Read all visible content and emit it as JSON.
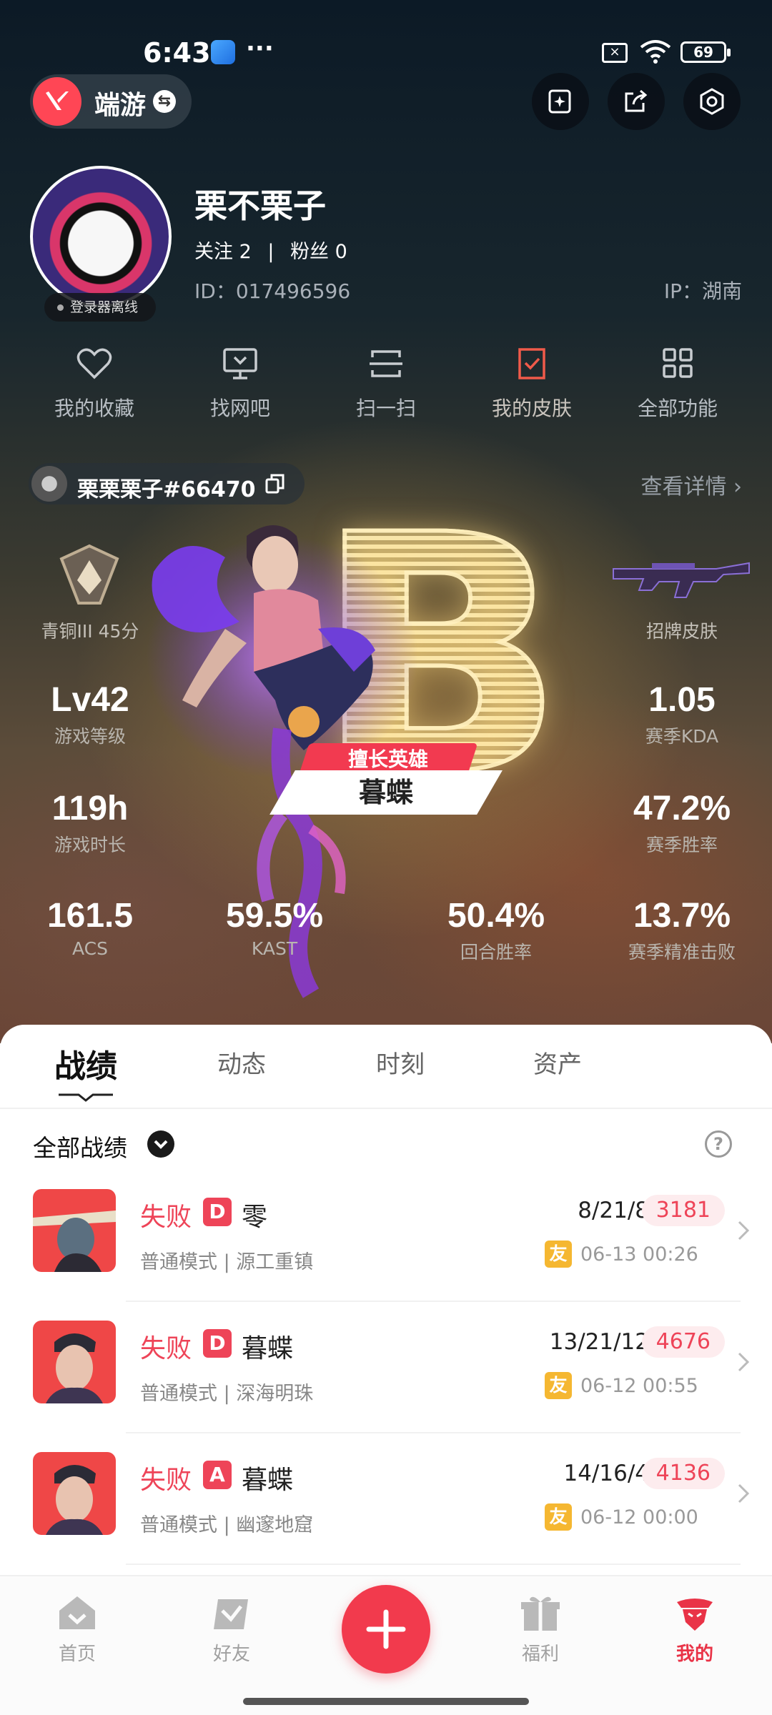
{
  "status_bar": {
    "time": "6:43",
    "dots": "···",
    "battery": "69"
  },
  "header": {
    "game_name": "端游"
  },
  "profile": {
    "nickname": "栗不栗子",
    "follow_label": "关注 2",
    "separator": "|",
    "fans_label": "粉丝 0",
    "id": "ID：017496596",
    "ip": "IP：湖南",
    "status_badge": "登录器离线"
  },
  "quick_actions": [
    {
      "label": "我的收藏",
      "icon": "heart-icon"
    },
    {
      "label": "找网吧",
      "icon": "monitor-icon"
    },
    {
      "label": "扫一扫",
      "icon": "scan-icon"
    },
    {
      "label": "我的皮肤",
      "icon": "skin-check-icon"
    },
    {
      "label": "全部功能",
      "icon": "grid-icon"
    }
  ],
  "game_card": {
    "riot_id": "栗栗栗子#66470",
    "details_link": "查看详情 ›",
    "grade_letter": "B",
    "rank": "青铜III 45分",
    "skin": "招牌皮肤",
    "best_hero_tag": "擅长英雄",
    "best_hero": "暮蝶",
    "stats": [
      {
        "value": "Lv42",
        "label": "游戏等级"
      },
      {
        "value": "1.05",
        "label": "赛季KDA"
      },
      {
        "value": "119h",
        "label": "游戏时长"
      },
      {
        "value": "47.2%",
        "label": "赛季胜率"
      },
      {
        "value": "161.5",
        "label": "ACS"
      },
      {
        "value": "59.5%",
        "label": "KAST"
      },
      {
        "value": "50.4%",
        "label": "回合胜率"
      },
      {
        "value": "13.7%",
        "label": "赛季精准击败"
      }
    ]
  },
  "tabs": [
    "战绩",
    "动态",
    "时刻",
    "资产"
  ],
  "records": {
    "filter_label": "全部战绩",
    "help": "?",
    "matches": [
      {
        "result": "失败",
        "grade": "D",
        "agent": "零",
        "mode": "普通模式 | 源工重镇",
        "kda": "8/21/8",
        "score": "3181",
        "friend": "友",
        "time": "06-13 00:26"
      },
      {
        "result": "失败",
        "grade": "D",
        "agent": "暮蝶",
        "mode": "普通模式 | 深海明珠",
        "kda": "13/21/12",
        "score": "4676",
        "friend": "友",
        "time": "06-12 00:55"
      },
      {
        "result": "失败",
        "grade": "A",
        "agent": "暮蝶",
        "mode": "普通模式 | 幽邃地窟",
        "kda": "14/16/4",
        "score": "4136",
        "friend": "友",
        "time": "06-12 00:00"
      }
    ]
  },
  "bottom_nav": [
    {
      "label": "首页"
    },
    {
      "label": "好友"
    },
    {
      "label": "福利"
    },
    {
      "label": "我的"
    }
  ],
  "colors": {
    "accent": "#f23a4d",
    "loss_red": "#ee4458",
    "friend_badge": "#f5b731"
  }
}
